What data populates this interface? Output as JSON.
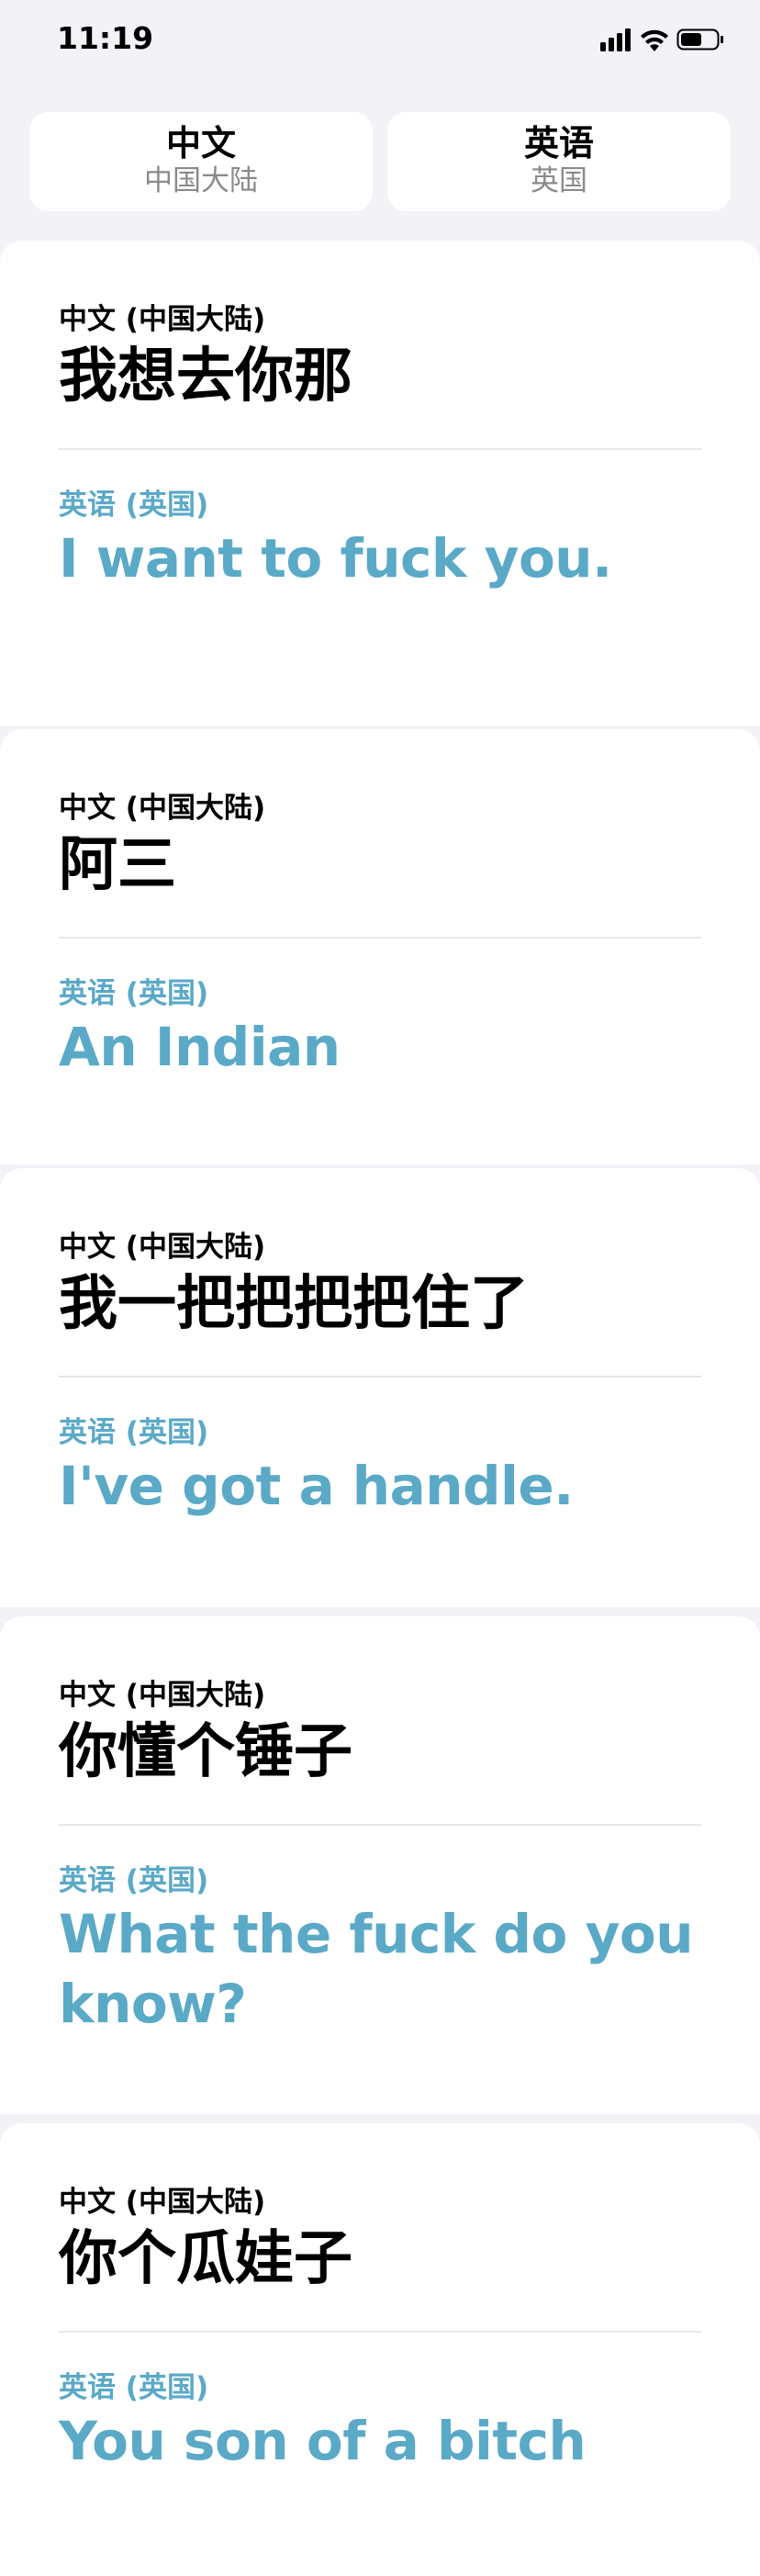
{
  "status_bar": {
    "time": "11:19"
  },
  "languages": {
    "source": {
      "name": "中文",
      "region": "中国大陆"
    },
    "target": {
      "name": "英语",
      "region": "英国"
    }
  },
  "translations": [
    {
      "source_label": "中文 (中国大陆)",
      "source_text": "我想去你那",
      "target_label": "英语 (英国)",
      "target_text": "I want to fuck you."
    },
    {
      "source_label": "中文 (中国大陆)",
      "source_text": "阿三",
      "target_label": "英语 (英国)",
      "target_text": "An Indian"
    },
    {
      "source_label": "中文 (中国大陆)",
      "source_text": "我一把把把把住了",
      "target_label": "英语 (英国)",
      "target_text": "I've got a handle."
    },
    {
      "source_label": "中文 (中国大陆)",
      "source_text": "你懂个锤子",
      "target_label": "英语 (英国)",
      "target_text": "What the fuck do you know?"
    },
    {
      "source_label": "中文 (中国大陆)",
      "source_text": "你个瓜娃子",
      "target_label": "英语 (英国)",
      "target_text": "You son of a bitch"
    }
  ],
  "colors": {
    "accent": "#5aa9c7",
    "background": "#f2f2f7",
    "card": "#ffffff"
  }
}
